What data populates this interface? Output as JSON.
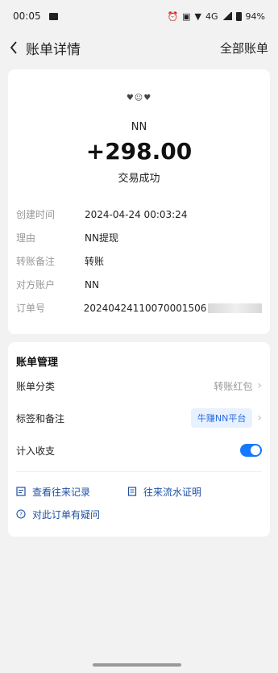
{
  "status_bar": {
    "time": "00:05",
    "battery": "94%",
    "network": "4G"
  },
  "nav": {
    "title": "账单详情",
    "right_link": "全部账单"
  },
  "bill": {
    "counterparty": "NN",
    "amount": "+298.00",
    "status": "交易成功",
    "details": [
      {
        "label": "创建时间",
        "value": "2024-04-24 00:03:24"
      },
      {
        "label": "理由",
        "value": "NN提现"
      },
      {
        "label": "转账备注",
        "value": "转账"
      },
      {
        "label": "对方账户",
        "value": "NN"
      },
      {
        "label": "订单号",
        "value": "20240424110070001506"
      }
    ]
  },
  "manage": {
    "title": "账单管理",
    "category_label": "账单分类",
    "category_value": "转账红包",
    "tags_label": "标签和备注",
    "tag_value": "牛赚NN平台",
    "count_label": "计入收支",
    "count_enabled": true,
    "link_history": "查看往来记录",
    "link_proof": "往来流水证明",
    "link_question": "对此订单有疑问"
  },
  "colors": {
    "accent": "#1677ff",
    "link": "#1e4fa3",
    "tag_bg": "#e8f1ff"
  }
}
